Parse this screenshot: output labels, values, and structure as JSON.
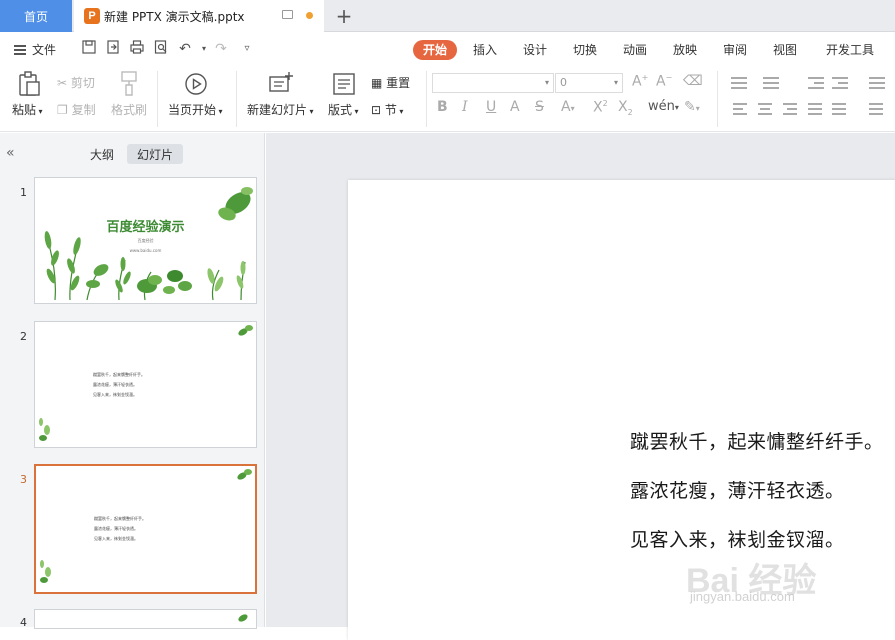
{
  "tabs": {
    "home": "首页",
    "document": "新建 PPTX 演示文稿.pptx",
    "doc_icon": "P"
  },
  "menu": {
    "file": "文件",
    "ribbon_tabs": [
      "开始",
      "插入",
      "设计",
      "切换",
      "动画",
      "放映",
      "审阅",
      "视图",
      "开发工具"
    ],
    "active_tab": "开始"
  },
  "ribbon": {
    "paste": "粘贴",
    "cut": "剪切",
    "copy": "复制",
    "format_painter": "格式刷",
    "play_from_current": "当页开始",
    "new_slide": "新建幻灯片",
    "layout": "版式",
    "reset": "重置",
    "section": "节",
    "font_size": "0"
  },
  "left_panel": {
    "outline_tab": "大纲",
    "slides_tab": "幻灯片",
    "slides": [
      {
        "number": "1",
        "title": "百度经验演示",
        "sub1": "百度经验",
        "sub2": "www.baidu.com"
      },
      {
        "number": "2",
        "lines": [
          "蹴罢秋千，起来慵整纤纤手。",
          "露浓花瘦，薄汗轻衣透。",
          "见客入来，袜刬金钗溜。"
        ]
      },
      {
        "number": "3",
        "lines": [
          "蹴罢秋千，起来慵整纤纤手。",
          "露浓花瘦，薄汗轻衣透。",
          "见客入来，袜刬金钗溜。"
        ]
      },
      {
        "number": "4"
      }
    ],
    "active_slide": "3"
  },
  "main_slide": {
    "lines": [
      "蹴罢秋千，起来慵整纤纤手。",
      "露浓花瘦，薄汗轻衣透。",
      "见客入来，袜刬金钗溜。"
    ]
  },
  "watermark": {
    "main": "Bai 经验",
    "sub": "jingyan.baidu.com"
  },
  "colors": {
    "accent_active_tab": "#e5663f",
    "home_tab": "#4f8fe8",
    "slide_border_active": "#d9733b",
    "title_green": "#3c8b33"
  }
}
